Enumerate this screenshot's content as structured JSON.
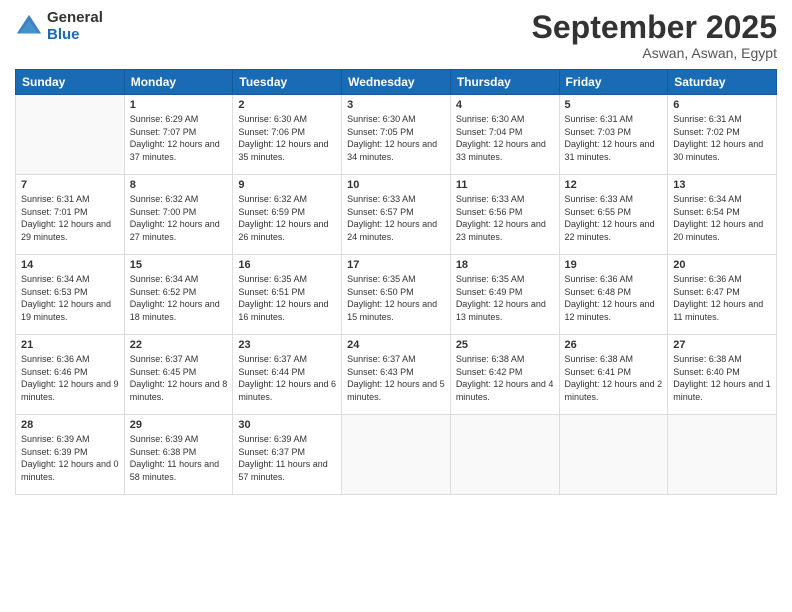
{
  "logo": {
    "general": "General",
    "blue": "Blue"
  },
  "header": {
    "month": "September 2025",
    "location": "Aswan, Aswan, Egypt"
  },
  "weekdays": [
    "Sunday",
    "Monday",
    "Tuesday",
    "Wednesday",
    "Thursday",
    "Friday",
    "Saturday"
  ],
  "weeks": [
    [
      {
        "day": "",
        "sunrise": "",
        "sunset": "",
        "daylight": ""
      },
      {
        "day": "1",
        "sunrise": "Sunrise: 6:29 AM",
        "sunset": "Sunset: 7:07 PM",
        "daylight": "Daylight: 12 hours and 37 minutes."
      },
      {
        "day": "2",
        "sunrise": "Sunrise: 6:30 AM",
        "sunset": "Sunset: 7:06 PM",
        "daylight": "Daylight: 12 hours and 35 minutes."
      },
      {
        "day": "3",
        "sunrise": "Sunrise: 6:30 AM",
        "sunset": "Sunset: 7:05 PM",
        "daylight": "Daylight: 12 hours and 34 minutes."
      },
      {
        "day": "4",
        "sunrise": "Sunrise: 6:30 AM",
        "sunset": "Sunset: 7:04 PM",
        "daylight": "Daylight: 12 hours and 33 minutes."
      },
      {
        "day": "5",
        "sunrise": "Sunrise: 6:31 AM",
        "sunset": "Sunset: 7:03 PM",
        "daylight": "Daylight: 12 hours and 31 minutes."
      },
      {
        "day": "6",
        "sunrise": "Sunrise: 6:31 AM",
        "sunset": "Sunset: 7:02 PM",
        "daylight": "Daylight: 12 hours and 30 minutes."
      }
    ],
    [
      {
        "day": "7",
        "sunrise": "Sunrise: 6:31 AM",
        "sunset": "Sunset: 7:01 PM",
        "daylight": "Daylight: 12 hours and 29 minutes."
      },
      {
        "day": "8",
        "sunrise": "Sunrise: 6:32 AM",
        "sunset": "Sunset: 7:00 PM",
        "daylight": "Daylight: 12 hours and 27 minutes."
      },
      {
        "day": "9",
        "sunrise": "Sunrise: 6:32 AM",
        "sunset": "Sunset: 6:59 PM",
        "daylight": "Daylight: 12 hours and 26 minutes."
      },
      {
        "day": "10",
        "sunrise": "Sunrise: 6:33 AM",
        "sunset": "Sunset: 6:57 PM",
        "daylight": "Daylight: 12 hours and 24 minutes."
      },
      {
        "day": "11",
        "sunrise": "Sunrise: 6:33 AM",
        "sunset": "Sunset: 6:56 PM",
        "daylight": "Daylight: 12 hours and 23 minutes."
      },
      {
        "day": "12",
        "sunrise": "Sunrise: 6:33 AM",
        "sunset": "Sunset: 6:55 PM",
        "daylight": "Daylight: 12 hours and 22 minutes."
      },
      {
        "day": "13",
        "sunrise": "Sunrise: 6:34 AM",
        "sunset": "Sunset: 6:54 PM",
        "daylight": "Daylight: 12 hours and 20 minutes."
      }
    ],
    [
      {
        "day": "14",
        "sunrise": "Sunrise: 6:34 AM",
        "sunset": "Sunset: 6:53 PM",
        "daylight": "Daylight: 12 hours and 19 minutes."
      },
      {
        "day": "15",
        "sunrise": "Sunrise: 6:34 AM",
        "sunset": "Sunset: 6:52 PM",
        "daylight": "Daylight: 12 hours and 18 minutes."
      },
      {
        "day": "16",
        "sunrise": "Sunrise: 6:35 AM",
        "sunset": "Sunset: 6:51 PM",
        "daylight": "Daylight: 12 hours and 16 minutes."
      },
      {
        "day": "17",
        "sunrise": "Sunrise: 6:35 AM",
        "sunset": "Sunset: 6:50 PM",
        "daylight": "Daylight: 12 hours and 15 minutes."
      },
      {
        "day": "18",
        "sunrise": "Sunrise: 6:35 AM",
        "sunset": "Sunset: 6:49 PM",
        "daylight": "Daylight: 12 hours and 13 minutes."
      },
      {
        "day": "19",
        "sunrise": "Sunrise: 6:36 AM",
        "sunset": "Sunset: 6:48 PM",
        "daylight": "Daylight: 12 hours and 12 minutes."
      },
      {
        "day": "20",
        "sunrise": "Sunrise: 6:36 AM",
        "sunset": "Sunset: 6:47 PM",
        "daylight": "Daylight: 12 hours and 11 minutes."
      }
    ],
    [
      {
        "day": "21",
        "sunrise": "Sunrise: 6:36 AM",
        "sunset": "Sunset: 6:46 PM",
        "daylight": "Daylight: 12 hours and 9 minutes."
      },
      {
        "day": "22",
        "sunrise": "Sunrise: 6:37 AM",
        "sunset": "Sunset: 6:45 PM",
        "daylight": "Daylight: 12 hours and 8 minutes."
      },
      {
        "day": "23",
        "sunrise": "Sunrise: 6:37 AM",
        "sunset": "Sunset: 6:44 PM",
        "daylight": "Daylight: 12 hours and 6 minutes."
      },
      {
        "day": "24",
        "sunrise": "Sunrise: 6:37 AM",
        "sunset": "Sunset: 6:43 PM",
        "daylight": "Daylight: 12 hours and 5 minutes."
      },
      {
        "day": "25",
        "sunrise": "Sunrise: 6:38 AM",
        "sunset": "Sunset: 6:42 PM",
        "daylight": "Daylight: 12 hours and 4 minutes."
      },
      {
        "day": "26",
        "sunrise": "Sunrise: 6:38 AM",
        "sunset": "Sunset: 6:41 PM",
        "daylight": "Daylight: 12 hours and 2 minutes."
      },
      {
        "day": "27",
        "sunrise": "Sunrise: 6:38 AM",
        "sunset": "Sunset: 6:40 PM",
        "daylight": "Daylight: 12 hours and 1 minute."
      }
    ],
    [
      {
        "day": "28",
        "sunrise": "Sunrise: 6:39 AM",
        "sunset": "Sunset: 6:39 PM",
        "daylight": "Daylight: 12 hours and 0 minutes."
      },
      {
        "day": "29",
        "sunrise": "Sunrise: 6:39 AM",
        "sunset": "Sunset: 6:38 PM",
        "daylight": "Daylight: 11 hours and 58 minutes."
      },
      {
        "day": "30",
        "sunrise": "Sunrise: 6:39 AM",
        "sunset": "Sunset: 6:37 PM",
        "daylight": "Daylight: 11 hours and 57 minutes."
      },
      {
        "day": "",
        "sunrise": "",
        "sunset": "",
        "daylight": ""
      },
      {
        "day": "",
        "sunrise": "",
        "sunset": "",
        "daylight": ""
      },
      {
        "day": "",
        "sunrise": "",
        "sunset": "",
        "daylight": ""
      },
      {
        "day": "",
        "sunrise": "",
        "sunset": "",
        "daylight": ""
      }
    ]
  ]
}
